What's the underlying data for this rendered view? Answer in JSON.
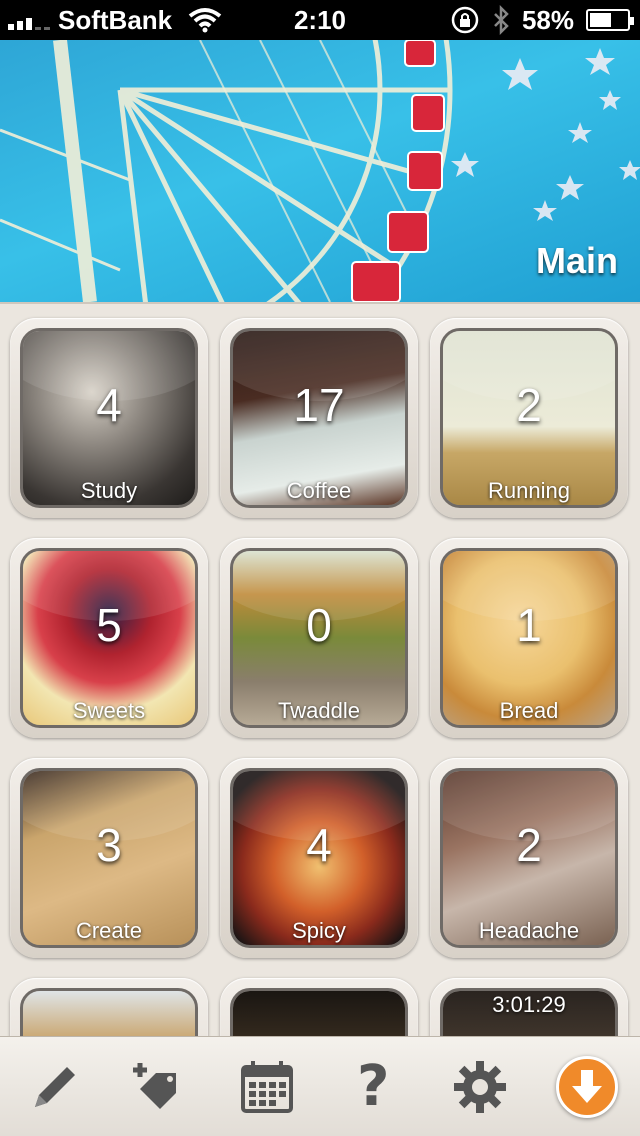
{
  "status_bar": {
    "carrier": "SoftBank",
    "time": "2:10",
    "battery": "58%",
    "battery_level": 0.58,
    "icons": [
      "signal-icon",
      "wifi-icon",
      "rotation-lock-icon",
      "bluetooth-icon",
      "battery-icon"
    ]
  },
  "header": {
    "title": "Main"
  },
  "tiles": [
    {
      "label": "Study",
      "count": "4"
    },
    {
      "label": "Coffee",
      "count": "17"
    },
    {
      "label": "Running",
      "count": "2"
    },
    {
      "label": "Sweets",
      "count": "5"
    },
    {
      "label": "Twaddle",
      "count": "0"
    },
    {
      "label": "Bread",
      "count": "1"
    },
    {
      "label": "Create",
      "count": "3"
    },
    {
      "label": "Spicy",
      "count": "4"
    },
    {
      "label": "Headache",
      "count": "2"
    }
  ],
  "partial_row": {
    "timer": "3:01:29"
  },
  "toolbar": {
    "icons": [
      "pencil-icon",
      "add-tag-icon",
      "calendar-icon",
      "help-icon",
      "settings-icon",
      "download-icon"
    ],
    "help_glyph": "?",
    "accent_color": "#f08a2a"
  }
}
